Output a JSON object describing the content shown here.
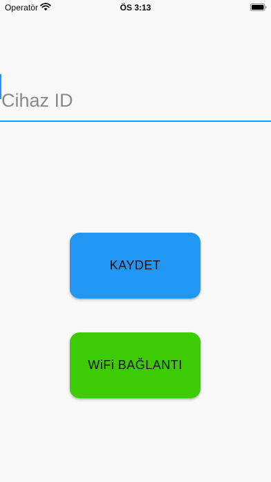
{
  "status_bar": {
    "carrier": "Operatör",
    "time": "ÖS 3:13",
    "icons": [
      "wifi-icon",
      "battery-icon"
    ]
  },
  "device_field": {
    "placeholder": "Cihaz ID",
    "value": ""
  },
  "buttons": {
    "save_label": "KAYDET",
    "wifi_label": "WiFi BAĞLANTI"
  },
  "colors": {
    "accent": "#2196f3",
    "save_button": "#2196f3",
    "wifi_button": "#3dcb05",
    "background": "#f9f9f9"
  }
}
